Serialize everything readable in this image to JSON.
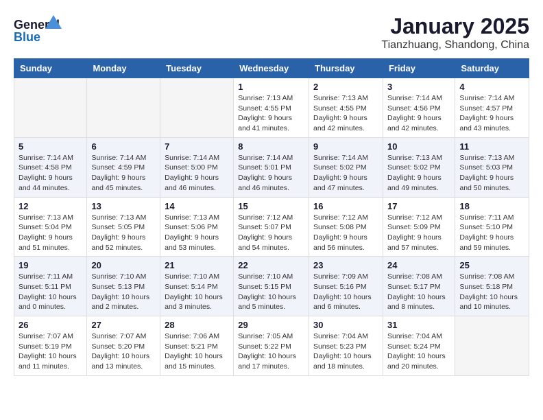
{
  "header": {
    "logo_general": "General",
    "logo_blue": "Blue",
    "month": "January 2025",
    "location": "Tianzhuang, Shandong, China"
  },
  "weekdays": [
    "Sunday",
    "Monday",
    "Tuesday",
    "Wednesday",
    "Thursday",
    "Friday",
    "Saturday"
  ],
  "weeks": [
    [
      {
        "day": "",
        "info": ""
      },
      {
        "day": "",
        "info": ""
      },
      {
        "day": "",
        "info": ""
      },
      {
        "day": "1",
        "info": "Sunrise: 7:13 AM\nSunset: 4:55 PM\nDaylight: 9 hours\nand 41 minutes."
      },
      {
        "day": "2",
        "info": "Sunrise: 7:13 AM\nSunset: 4:55 PM\nDaylight: 9 hours\nand 42 minutes."
      },
      {
        "day": "3",
        "info": "Sunrise: 7:14 AM\nSunset: 4:56 PM\nDaylight: 9 hours\nand 42 minutes."
      },
      {
        "day": "4",
        "info": "Sunrise: 7:14 AM\nSunset: 4:57 PM\nDaylight: 9 hours\nand 43 minutes."
      }
    ],
    [
      {
        "day": "5",
        "info": "Sunrise: 7:14 AM\nSunset: 4:58 PM\nDaylight: 9 hours\nand 44 minutes."
      },
      {
        "day": "6",
        "info": "Sunrise: 7:14 AM\nSunset: 4:59 PM\nDaylight: 9 hours\nand 45 minutes."
      },
      {
        "day": "7",
        "info": "Sunrise: 7:14 AM\nSunset: 5:00 PM\nDaylight: 9 hours\nand 46 minutes."
      },
      {
        "day": "8",
        "info": "Sunrise: 7:14 AM\nSunset: 5:01 PM\nDaylight: 9 hours\nand 46 minutes."
      },
      {
        "day": "9",
        "info": "Sunrise: 7:14 AM\nSunset: 5:02 PM\nDaylight: 9 hours\nand 47 minutes."
      },
      {
        "day": "10",
        "info": "Sunrise: 7:13 AM\nSunset: 5:02 PM\nDaylight: 9 hours\nand 49 minutes."
      },
      {
        "day": "11",
        "info": "Sunrise: 7:13 AM\nSunset: 5:03 PM\nDaylight: 9 hours\nand 50 minutes."
      }
    ],
    [
      {
        "day": "12",
        "info": "Sunrise: 7:13 AM\nSunset: 5:04 PM\nDaylight: 9 hours\nand 51 minutes."
      },
      {
        "day": "13",
        "info": "Sunrise: 7:13 AM\nSunset: 5:05 PM\nDaylight: 9 hours\nand 52 minutes."
      },
      {
        "day": "14",
        "info": "Sunrise: 7:13 AM\nSunset: 5:06 PM\nDaylight: 9 hours\nand 53 minutes."
      },
      {
        "day": "15",
        "info": "Sunrise: 7:12 AM\nSunset: 5:07 PM\nDaylight: 9 hours\nand 54 minutes."
      },
      {
        "day": "16",
        "info": "Sunrise: 7:12 AM\nSunset: 5:08 PM\nDaylight: 9 hours\nand 56 minutes."
      },
      {
        "day": "17",
        "info": "Sunrise: 7:12 AM\nSunset: 5:09 PM\nDaylight: 9 hours\nand 57 minutes."
      },
      {
        "day": "18",
        "info": "Sunrise: 7:11 AM\nSunset: 5:10 PM\nDaylight: 9 hours\nand 59 minutes."
      }
    ],
    [
      {
        "day": "19",
        "info": "Sunrise: 7:11 AM\nSunset: 5:11 PM\nDaylight: 10 hours\nand 0 minutes."
      },
      {
        "day": "20",
        "info": "Sunrise: 7:10 AM\nSunset: 5:13 PM\nDaylight: 10 hours\nand 2 minutes."
      },
      {
        "day": "21",
        "info": "Sunrise: 7:10 AM\nSunset: 5:14 PM\nDaylight: 10 hours\nand 3 minutes."
      },
      {
        "day": "22",
        "info": "Sunrise: 7:10 AM\nSunset: 5:15 PM\nDaylight: 10 hours\nand 5 minutes."
      },
      {
        "day": "23",
        "info": "Sunrise: 7:09 AM\nSunset: 5:16 PM\nDaylight: 10 hours\nand 6 minutes."
      },
      {
        "day": "24",
        "info": "Sunrise: 7:08 AM\nSunset: 5:17 PM\nDaylight: 10 hours\nand 8 minutes."
      },
      {
        "day": "25",
        "info": "Sunrise: 7:08 AM\nSunset: 5:18 PM\nDaylight: 10 hours\nand 10 minutes."
      }
    ],
    [
      {
        "day": "26",
        "info": "Sunrise: 7:07 AM\nSunset: 5:19 PM\nDaylight: 10 hours\nand 11 minutes."
      },
      {
        "day": "27",
        "info": "Sunrise: 7:07 AM\nSunset: 5:20 PM\nDaylight: 10 hours\nand 13 minutes."
      },
      {
        "day": "28",
        "info": "Sunrise: 7:06 AM\nSunset: 5:21 PM\nDaylight: 10 hours\nand 15 minutes."
      },
      {
        "day": "29",
        "info": "Sunrise: 7:05 AM\nSunset: 5:22 PM\nDaylight: 10 hours\nand 17 minutes."
      },
      {
        "day": "30",
        "info": "Sunrise: 7:04 AM\nSunset: 5:23 PM\nDaylight: 10 hours\nand 18 minutes."
      },
      {
        "day": "31",
        "info": "Sunrise: 7:04 AM\nSunset: 5:24 PM\nDaylight: 10 hours\nand 20 minutes."
      },
      {
        "day": "",
        "info": ""
      }
    ]
  ]
}
